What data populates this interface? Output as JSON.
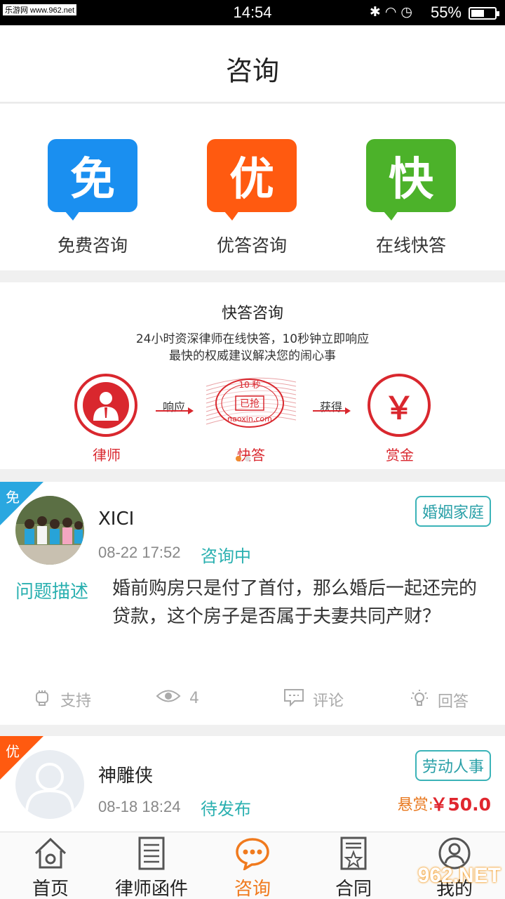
{
  "status_bar": {
    "watermark": "乐游网 www.962.net",
    "time": "14:54",
    "battery_percent": "55%",
    "battery_level": 0.55,
    "icons": [
      "bluetooth-icon",
      "headset-icon",
      "alarm-icon"
    ]
  },
  "header": {
    "title": "咨询"
  },
  "consult_types": [
    {
      "icon_char": "免",
      "label": "免费咨询",
      "color": "#1a8ff0"
    },
    {
      "icon_char": "优",
      "label": "优答咨询",
      "color": "#ff5a10"
    },
    {
      "icon_char": "快",
      "label": "在线快答",
      "color": "#4cb22a"
    }
  ],
  "banner": {
    "title": "快答咨询",
    "line1": "24小时资深律师在线快答，10秒钟立即响应",
    "line2": "最快的权威建议解决您的闹心事",
    "step1": "律师",
    "arrow1": "响应",
    "stamp_top": "10 秒",
    "stamp_mid": "已抢",
    "stamp_bottom": "naoxin.com",
    "step2": "快答",
    "arrow2": "获得",
    "yen": "￥",
    "step3": "赏金",
    "active_dot": 0
  },
  "questions": [
    {
      "ribbon": "免",
      "ribbon_color": "#2aa7e0",
      "name": "XICI",
      "time": "08-22 17:52",
      "status": "咨询中",
      "tag": "婚姻家庭",
      "desc_label": "问题描述",
      "desc": "婚前购房只是付了首付，那么婚后一起还完的贷款，这个房子是否属于夫妻共同产财？",
      "support": "支持",
      "views": "4",
      "comment": "评论",
      "answer": "回答"
    },
    {
      "ribbon": "优",
      "ribbon_color": "#ff5a10",
      "name": "神雕侠",
      "time": "08-18 18:24",
      "status": "待发布",
      "tag": "劳动人事",
      "reward_label": "悬赏:",
      "reward_value": "￥50.0"
    }
  ],
  "tabbar": [
    {
      "label": "首页",
      "icon": "home-icon"
    },
    {
      "label": "律师函件",
      "icon": "document-icon"
    },
    {
      "label": "咨询",
      "icon": "chat-icon",
      "active": true
    },
    {
      "label": "合同",
      "icon": "contract-icon"
    },
    {
      "label": "我的",
      "icon": "user-icon"
    }
  ],
  "brand_watermark": "962.NET"
}
